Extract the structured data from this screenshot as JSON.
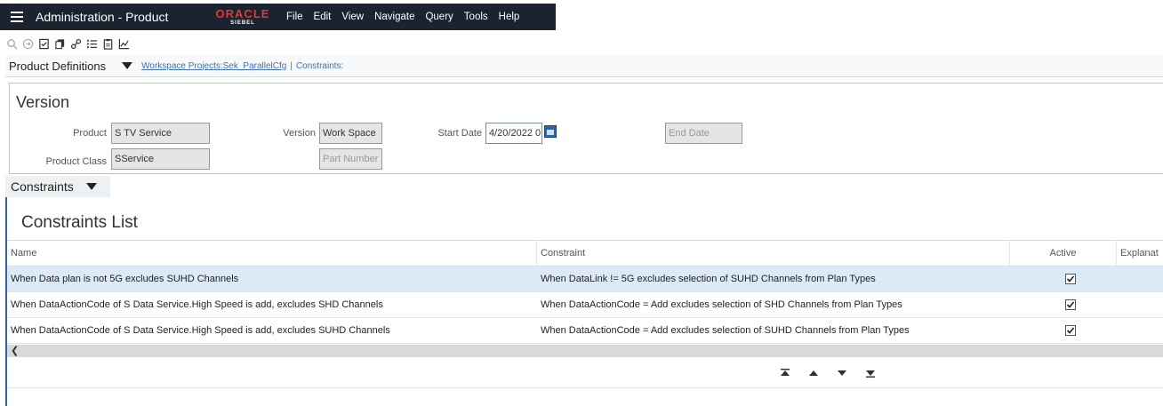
{
  "header": {
    "app_title": "Administration - Product",
    "logo_top": "ORACLE",
    "logo_bottom": "SIEBEL",
    "menu": [
      "File",
      "Edit",
      "View",
      "Navigate",
      "Query",
      "Tools",
      "Help"
    ]
  },
  "toolbar": {
    "icons": [
      "search-icon",
      "circle-arrow-icon",
      "checklist-icon",
      "copy-icon",
      "link-icon",
      "list-icon",
      "clipboard-icon",
      "chart-icon"
    ]
  },
  "breadcrumb": {
    "main": "Product Definitions",
    "link1": "Workspace Projects:Sek_ParallelCfg",
    "separator": "|",
    "link2": "Constraints:"
  },
  "version": {
    "title": "Version",
    "product_label": "Product",
    "product_value": "S TV Service",
    "product_class_label": "Product Class",
    "product_class_value": "SService",
    "version_label": "Version",
    "version_value": "Work Space",
    "part_number_placeholder": "Part Number",
    "start_date_label": "Start Date",
    "start_date_value": "4/20/2022 0",
    "end_date_placeholder": "End Date"
  },
  "constraints_tab": {
    "label": "Constraints"
  },
  "constraints_list": {
    "title": "Constraints List",
    "columns": [
      "Name",
      "Constraint",
      "Active",
      "Explanat"
    ],
    "rows": [
      {
        "name": "When Data plan is not 5G excludes SUHD Channels",
        "constraint": "When DataLink != 5G excludes selection of SUHD Channels from Plan Types",
        "active": true
      },
      {
        "name": "When DataActionCode of S Data Service.High Speed is add, excludes SHD Channels",
        "constraint": "When DataActionCode = Add excludes selection of SHD Channels from Plan Types",
        "active": true
      },
      {
        "name": "When DataActionCode of S Data Service.High Speed is add, excludes SUHD Channels",
        "constraint": "When DataActionCode = Add excludes selection of SUHD Channels from Plan Types",
        "active": true
      }
    ]
  },
  "colors": {
    "header_bg": "#1b2331",
    "selected_row": "#dceaf6",
    "link": "#3f73a8",
    "oracle_red": "#e03a2f"
  }
}
